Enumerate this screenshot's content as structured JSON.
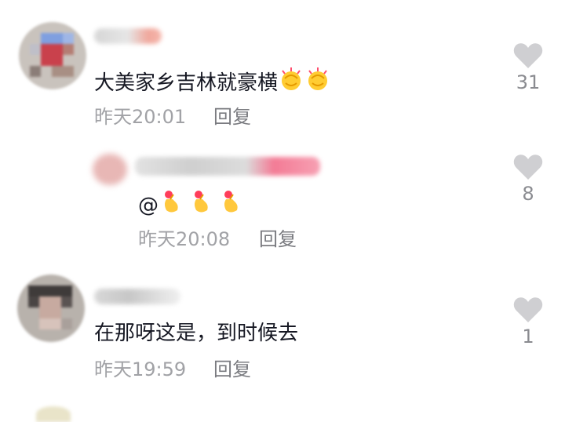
{
  "comments": [
    {
      "text": "大美家乡吉林就豪横",
      "time": "昨天20:01",
      "reply_label": "回复",
      "likes": "31",
      "emoji": [
        "clapping-hands",
        "clapping-hands"
      ]
    },
    {
      "text": "在那呀这是，到时候去",
      "time": "昨天19:59",
      "reply_label": "回复",
      "likes": "1"
    }
  ],
  "reply": {
    "text": "@",
    "time": "昨天20:08",
    "reply_label": "回复",
    "likes": "8",
    "emoji": [
      "heart-fingers",
      "heart-fingers",
      "heart-fingers"
    ]
  },
  "colors": {
    "text": "#161823",
    "meta": "#a1a2a6",
    "heart": "#cfcfd2"
  }
}
